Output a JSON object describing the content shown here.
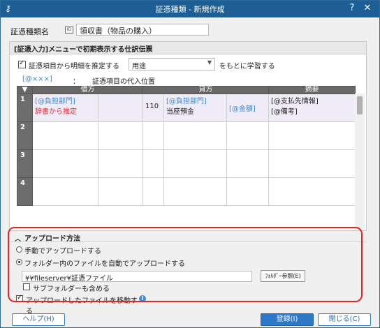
{
  "window": {
    "title": "証憑種類 - 新規作成",
    "app_icon": "key-icon",
    "help_icon_label": "?",
    "close_icon_label": "✕"
  },
  "kind": {
    "label": "証憑種類名",
    "icon_text": "ID",
    "value": "領収書（物品の購入）"
  },
  "slip_panel": {
    "header": "[証憑入力]メニューで初期表示する仕訳伝票",
    "estimate_checked": true,
    "estimate_label": "証憑項目から明細を推定する",
    "estimate_select": "用途",
    "estimate_suffix": "をもとに学習する",
    "placeholder_token": "[@×××]",
    "colon": "：",
    "placeholder_desc": "証憑項目の代入位置",
    "columns": {
      "debit": "借方",
      "credit": "貸方",
      "summary": "摘要"
    },
    "rows": [
      {
        "no": "1",
        "debit_dept": "[@負担部門]",
        "debit_account": "辞書から推定",
        "credit_dept": "[@負担部門]",
        "credit_code": "110",
        "credit_account": "当座預金",
        "credit_amount": "[@金額]",
        "summary_line1": "[@支払先情報]",
        "summary_line2": "[@備考]"
      },
      {
        "no": "2"
      },
      {
        "no": "3"
      },
      {
        "no": "4"
      }
    ]
  },
  "upload": {
    "header": "アップロード方法",
    "options": {
      "manual": "手動でアップロードする",
      "auto": "フォルダー内のファイルを自動でアップロードする"
    },
    "selected": "auto",
    "path": "¥¥fileserver¥証憑ファイル",
    "browse_label": "ﾌｫﾙﾀﾞｰ参照(E)",
    "include_sub_label": "サブフォルダーも含める",
    "include_sub_checked": false,
    "move_label": "アップロードしたファイルを移動する",
    "move_checked": true,
    "info_icon_label": "i"
  },
  "buttons": {
    "help": "ヘルプ(H)",
    "register": "登録(I)",
    "close": "閉じる(C)"
  },
  "colors": {
    "titlebar": "#1d5f95",
    "accent": "#2e78c8",
    "highlight": "#e52626",
    "placeholder_blue": "#3a8ad0",
    "inferred_red": "#e0303a"
  }
}
